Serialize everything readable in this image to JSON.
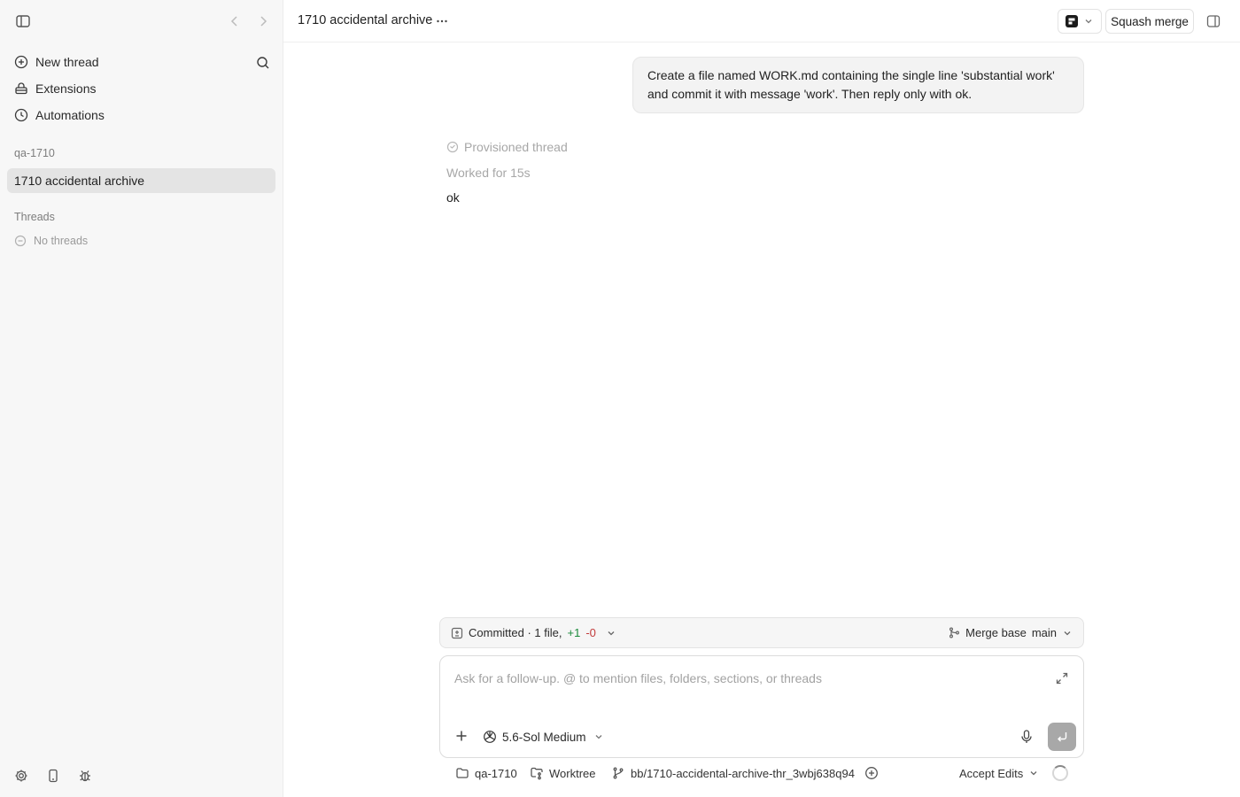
{
  "sidebar": {
    "nav": {
      "new_thread": "New thread",
      "extensions": "Extensions",
      "automations": "Automations"
    },
    "project_label": "qa-1710",
    "active_thread": "1710 accidental archive",
    "threads_label": "Threads",
    "no_threads": "No threads"
  },
  "header": {
    "title": "1710 accidental archive",
    "squash_merge": "Squash merge"
  },
  "conversation": {
    "user_message": "Create a file named WORK.md containing the single line 'substantial work' and commit it with message 'work'. Then reply only with ok.",
    "provisioned": "Provisioned thread",
    "worked_for": "Worked for 15s",
    "reply": "ok"
  },
  "commit_bar": {
    "committed_text": "Committed · 1 file,",
    "additions": "+1",
    "deletions": "-0",
    "merge_base_label": "Merge base",
    "merge_base_value": "main"
  },
  "composer": {
    "placeholder": "Ask for a follow-up. @ to mention files, folders, sections, or threads",
    "model": "5.6-Sol Medium"
  },
  "footer": {
    "project": "qa-1710",
    "worktree": "Worktree",
    "branch": "bb/1710-accidental-archive-thr_3wbj638q94",
    "accept_edits": "Accept Edits"
  },
  "colors": {
    "sidebar_bg": "#f7f7f7",
    "active_item_bg": "#e4e4e4",
    "addition": "#1a8a3a",
    "deletion": "#c23b3b",
    "send_button": "#a8a8a8"
  }
}
